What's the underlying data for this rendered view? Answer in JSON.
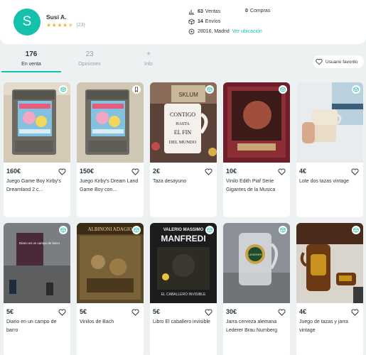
{
  "profile": {
    "avatar_letter": "S",
    "name": "Susi A.",
    "rating_stars": 4.5,
    "review_count": "(23)",
    "stats": {
      "ventas_count": "63",
      "ventas_label": "Ventas",
      "compras_count": "0",
      "compras_label": "Compras",
      "envios_count": "14",
      "envios_label": "Envíos",
      "location": "28016, Madrid",
      "location_link": "Ver ubicación"
    }
  },
  "tabs": [
    {
      "count": "176",
      "label": "En venta",
      "active": true
    },
    {
      "count": "23",
      "label": "Opiniones",
      "active": false
    },
    {
      "count": "+",
      "label": "Info",
      "active": false
    }
  ],
  "favorite_button": "Usuario favorito",
  "colors": {
    "accent": "#13c1ac",
    "star": "#e8b53b",
    "text": "#29363d",
    "muted": "#90a4ae"
  },
  "products": [
    {
      "price": "160€",
      "title": "Juego Game Boy Kirby's Dreamland 2 c...",
      "badge": "shipping-box-icon"
    },
    {
      "price": "150€",
      "title": "Juego Kirby's Dream Land Game Boy con...",
      "badge": "bookmark-icon"
    },
    {
      "price": "2€",
      "title": "Taza desayuno",
      "badge": "shipping-box-icon"
    },
    {
      "price": "10€",
      "title": "Vinilo Edith Piaf Serie Gigantes de la Musica",
      "badge": "shipping-box-icon"
    },
    {
      "price": "4€",
      "title": "Lote dos tazas vintage",
      "badge": "shipping-box-icon"
    },
    {
      "price": "5€",
      "title": "Diario en un campo de barro",
      "badge": "shipping-box-icon"
    },
    {
      "price": "5€",
      "title": "Vinilos de Bach",
      "badge": "shipping-box-icon"
    },
    {
      "price": "5€",
      "title": "Libro El caballero invisible",
      "badge": "shipping-box-icon"
    },
    {
      "price": "30€",
      "title": "Jarra cerveza alemana Lederer Brau Nurnberg",
      "badge": "shipping-box-icon"
    },
    {
      "price": "4€",
      "title": "Juego de tazas y jarra vintage",
      "badge": "shipping-box-icon"
    }
  ],
  "image_text": {
    "mug_line1": "CONTIGO",
    "mug_line2": "HASTA",
    "mug_line3": "EL FIN",
    "mug_line4": "DEL MUNDO",
    "sklum": "SKLUM",
    "albinoni": "ALBINONI ADAGIO",
    "book_author": "VALERIO MASSIMO",
    "book_title": "MANFREDI",
    "book_subtitle": "EL CABALLERO INVISIBLE",
    "diary_line": "Diario en un campo de barro",
    "beer_brand": "LEDERER"
  }
}
